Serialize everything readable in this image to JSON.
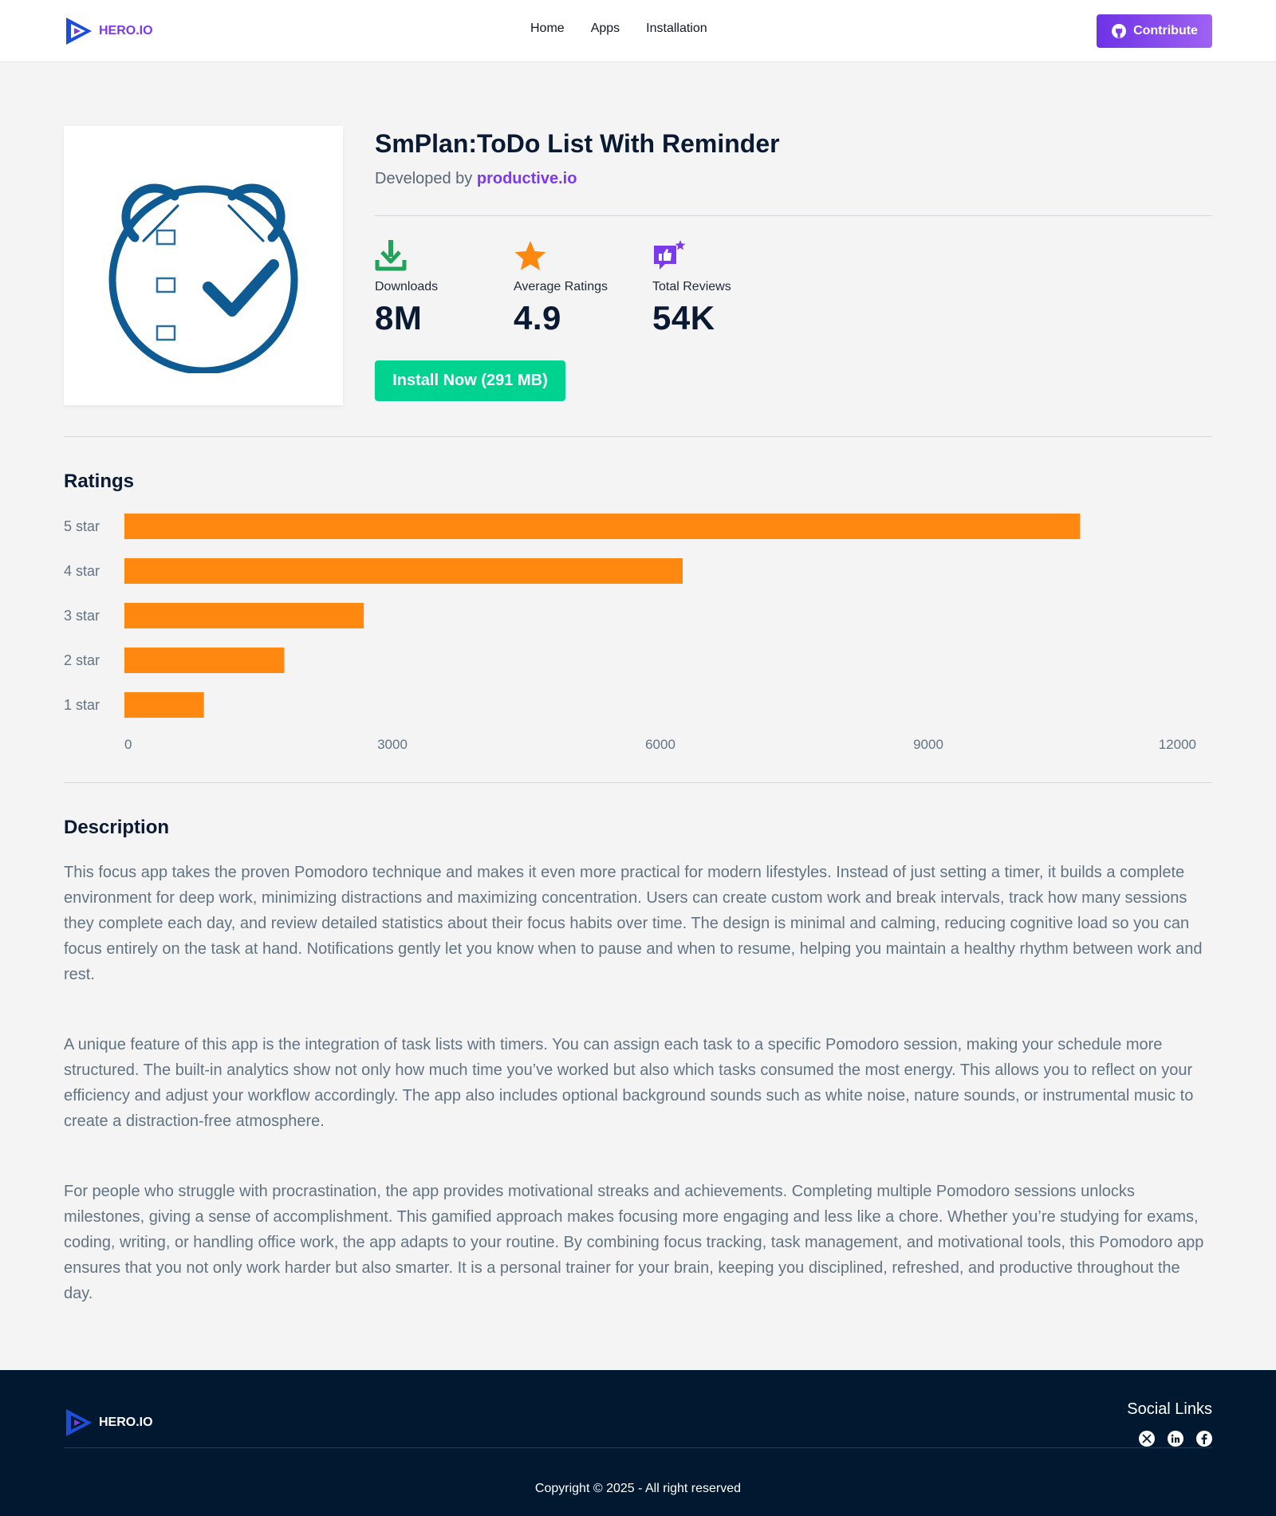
{
  "nav": {
    "logo_text": "HERO.IO",
    "links": [
      "Home",
      "Apps",
      "Installation"
    ],
    "contribute_label": "Contribute"
  },
  "app": {
    "title": "SmPlan:ToDo List With Reminder",
    "developed_by_prefix": "Developed by",
    "developer": "productive.io",
    "icon": "alarm-clock-checklist-icon",
    "stats": [
      {
        "label": "Downloads",
        "value": "8M",
        "icon": "download-icon",
        "color": "#22a35a"
      },
      {
        "label": "Average Ratings",
        "value": "4.9",
        "icon": "star-icon",
        "color": "#ff8811"
      },
      {
        "label": "Total Reviews",
        "value": "54K",
        "icon": "like-review-icon",
        "color": "#7c3aed"
      }
    ],
    "install_label": "Install Now (291 MB)"
  },
  "ratings": {
    "heading": "Ratings"
  },
  "chart_data": {
    "type": "bar",
    "orientation": "horizontal",
    "categories": [
      "5 star",
      "4 star",
      "3 star",
      "2 star",
      "1 star"
    ],
    "values": [
      10700,
      6250,
      2680,
      1790,
      890
    ],
    "xlim": [
      0,
      12000
    ],
    "xticks": [
      0,
      3000,
      6000,
      9000,
      12000
    ],
    "color": "#ff8811",
    "grid": false
  },
  "description": {
    "heading": "Description",
    "paragraphs": [
      "This focus app takes the proven Pomodoro technique and makes it even more practical for modern lifestyles. Instead of just setting a timer, it builds a complete environment for deep work, minimizing distractions and maximizing concentration. Users can create custom work and break intervals, track how many sessions they complete each day, and review detailed statistics about their focus habits over time. The design is minimal and calming, reducing cognitive load so you can focus entirely on the task at hand. Notifications gently let you know when to pause and when to resume, helping you maintain a healthy rhythm between work and rest.",
      "A unique feature of this app is the integration of task lists with timers. You can assign each task to a specific Pomodoro session, making your schedule more structured. The built-in analytics show not only how much time you’ve worked but also which tasks consumed the most energy. This allows you to reflect on your efficiency and adjust your workflow accordingly. The app also includes optional background sounds such as white noise, nature sounds, or instrumental music to create a distraction-free atmosphere.",
      "For people who struggle with procrastination, the app provides motivational streaks and achievements. Completing multiple Pomodoro sessions unlocks milestones, giving a sense of accomplishment. This gamified approach makes focusing more engaging and less like a chore. Whether you’re studying for exams, coding, writing, or handling office work, the app adapts to your routine. By combining focus tracking, task management, and motivational tools, this Pomodoro app ensures that you not only work harder but also smarter. It is a personal trainer for your brain, keeping you disciplined, refreshed, and productive throughout the day."
    ]
  },
  "footer": {
    "logo_text": "HERO.IO",
    "social_title": "Social Links",
    "social_icons": [
      "x-twitter-icon",
      "linkedin-icon",
      "facebook-icon"
    ],
    "copyright": "Copyright © 2025 - All right reserved"
  }
}
